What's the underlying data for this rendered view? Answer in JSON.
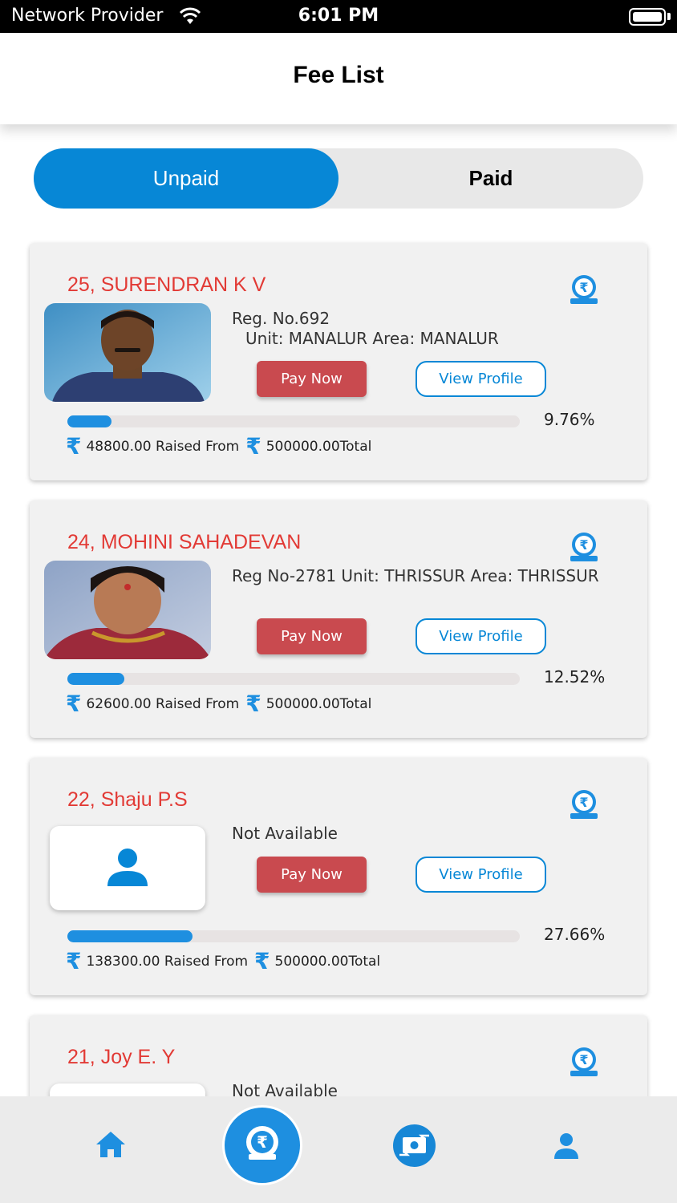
{
  "status_bar": {
    "provider": "Network Provider",
    "time": "6:01 PM"
  },
  "header": {
    "title": "Fee List"
  },
  "tabs": {
    "unpaid": "Unpaid",
    "paid": "Paid",
    "active": "Unpaid"
  },
  "colors": {
    "accent": "#0787d6",
    "name_red": "#e23a35",
    "pay_button": "#c94a4f"
  },
  "cards": [
    {
      "name": "25, SURENDRAN K V",
      "info_line1": "Reg. No.692",
      "info_line2": "Unit: MANALUR Area: MANALUR",
      "pay_label": "Pay Now",
      "view_label": "View Profile",
      "progress_fraction": 0.0976,
      "percent": "9.76%",
      "raised": "48800.00 Raised From",
      "total": "500000.00Total",
      "photo": "portrait-man"
    },
    {
      "name": "24, MOHINI SAHADEVAN",
      "info_line1": "Reg No-2781 Unit: THRISSUR Area: THRISSUR",
      "pay_label": "Pay Now",
      "view_label": "View Profile",
      "progress_fraction": 0.1252,
      "percent": "12.52%",
      "raised": "62600.00 Raised From",
      "total": "500000.00Total",
      "photo": "portrait-woman"
    },
    {
      "name": "22, Shaju P.S",
      "info_line1": "Not Available",
      "pay_label": "Pay Now",
      "view_label": "View Profile",
      "progress_fraction": 0.2766,
      "percent": "27.66%",
      "raised": "138300.00 Raised From",
      "total": "500000.00Total",
      "photo": "person-placeholder-icon"
    },
    {
      "name": "21, Joy E. Y",
      "info_line1": "Not Available"
    }
  ],
  "nav": {
    "items": [
      "home-icon",
      "fee-icon",
      "payment-icon",
      "profile-icon"
    ],
    "active": "fee-icon"
  }
}
